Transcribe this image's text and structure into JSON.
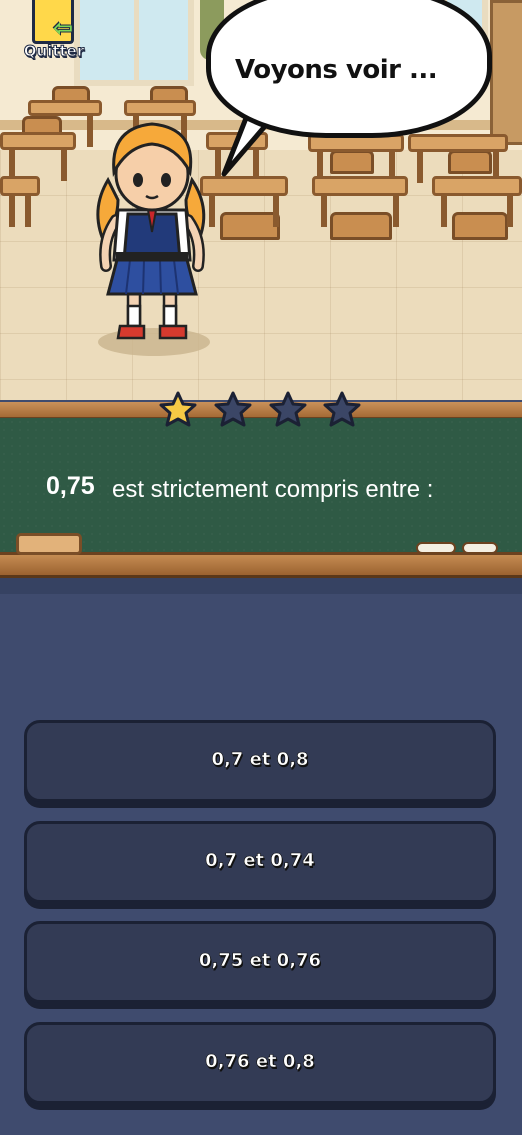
{
  "header": {
    "quit_label": "Quitter",
    "quit_icon": "exit-door-icon"
  },
  "speech_bubble": {
    "text": "Voyons voir ..."
  },
  "progress": {
    "stars_total": 4,
    "stars_earned": 1,
    "colors": {
      "earned": "#f6c945",
      "empty": "#3b4666"
    }
  },
  "question": {
    "number": "0,75",
    "text": "est strictement compris entre :"
  },
  "answers": [
    {
      "label": "0,7 et 0,8"
    },
    {
      "label": "0,7 et 0,74"
    },
    {
      "label": "0,75 et 0,76"
    },
    {
      "label": "0,76 et 0,8"
    }
  ],
  "colors": {
    "chalkboard": "#2f5a45",
    "background": "#3f4b6e",
    "answer_button": "#333b55"
  }
}
